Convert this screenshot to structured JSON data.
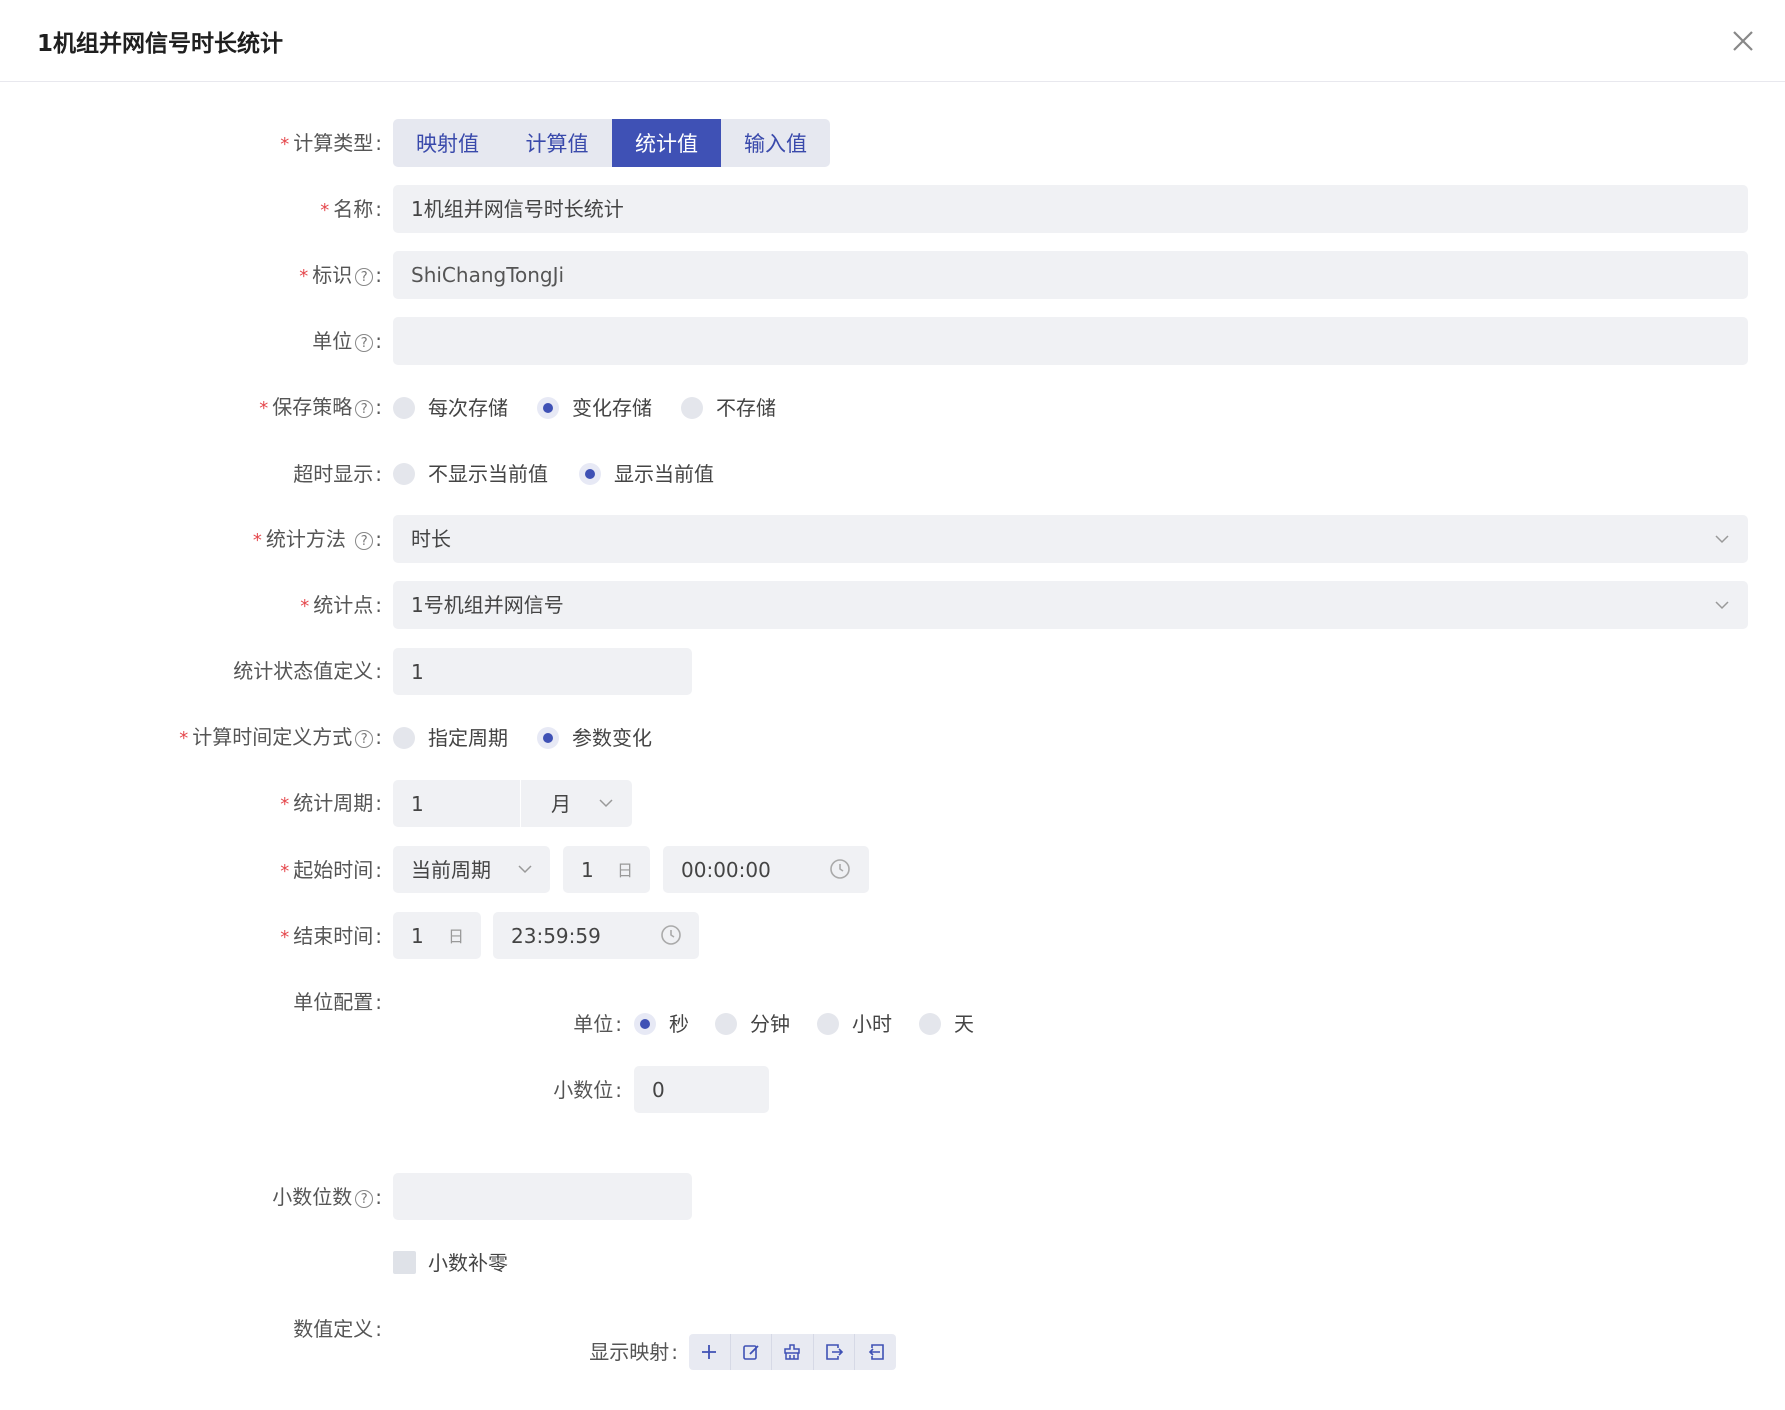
{
  "dialog": {
    "title": "1机组并网信号时长统计"
  },
  "calc_type": {
    "label": "计算类型",
    "options": [
      "映射值",
      "计算值",
      "统计值",
      "输入值"
    ],
    "selected": "统计值"
  },
  "name": {
    "label": "名称",
    "value": "1机组并网信号时长统计"
  },
  "identifier": {
    "label": "标识",
    "value": "ShiChangTongJi"
  },
  "unit": {
    "label": "单位",
    "value": ""
  },
  "save_strategy": {
    "label": "保存策略",
    "options": [
      "每次存储",
      "变化存储",
      "不存储"
    ],
    "selected": "变化存储"
  },
  "timeout_display": {
    "label": "超时显示",
    "options": [
      "不显示当前值",
      "显示当前值"
    ],
    "selected": "显示当前值"
  },
  "stat_method": {
    "label": "统计方法",
    "value": "时长"
  },
  "stat_point": {
    "label": "统计点",
    "value": "1号机组并网信号"
  },
  "stat_state_def": {
    "label": "统计状态值定义",
    "value": "1"
  },
  "calc_time_mode": {
    "label": "计算时间定义方式",
    "options": [
      "指定周期",
      "参数变化"
    ],
    "selected": "参数变化"
  },
  "stat_period": {
    "label": "统计周期",
    "value": "1",
    "unit": "月"
  },
  "start_time": {
    "label": "起始时间",
    "period": "当前周期",
    "day": "1",
    "day_unit": "日",
    "time": "00:00:00"
  },
  "end_time": {
    "label": "结束时间",
    "day": "1",
    "day_unit": "日",
    "time": "23:59:59"
  },
  "unit_config": {
    "label": "单位配置",
    "unit_label": "单位",
    "unit_options": [
      "秒",
      "分钟",
      "小时",
      "天"
    ],
    "unit_selected": "秒",
    "decimal_label": "小数位",
    "decimal_value": "0"
  },
  "decimal_places": {
    "label": "小数位数",
    "value": ""
  },
  "zero_pad": {
    "label": "小数补零",
    "checked": false
  },
  "value_def": {
    "label": "数值定义",
    "display_mapping_label": "显示映射"
  },
  "colors": {
    "accent": "#3f51b5",
    "required": "#e5484d",
    "field_bg": "#f0f1f4"
  },
  "icons": {
    "close": "close-icon",
    "help": "help-circle-icon",
    "chevron": "chevron-down-icon",
    "clock": "clock-icon",
    "toolbar": [
      "plus-icon",
      "edit-icon",
      "clear-icon",
      "export-icon",
      "import-icon"
    ]
  }
}
